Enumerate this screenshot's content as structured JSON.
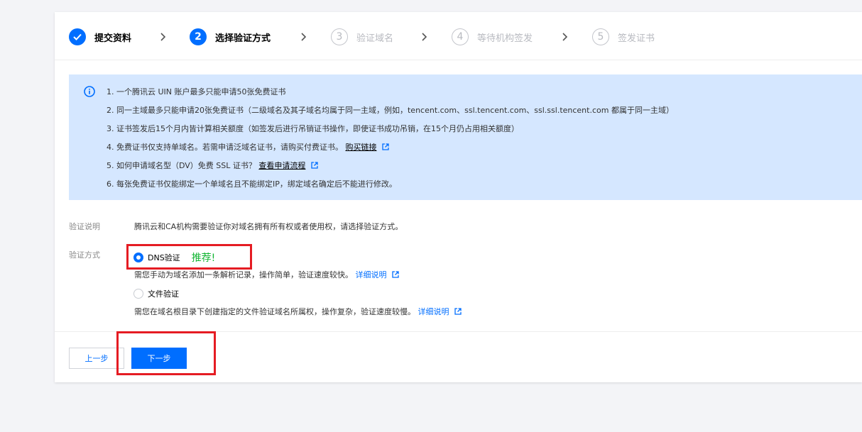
{
  "steps": [
    {
      "number": "",
      "label": "提交资料",
      "state": "done"
    },
    {
      "number": "2",
      "label": "选择验证方式",
      "state": "active"
    },
    {
      "number": "3",
      "label": "验证域名",
      "state": "pending"
    },
    {
      "number": "4",
      "label": "等待机构签发",
      "state": "pending"
    },
    {
      "number": "5",
      "label": "签发证书",
      "state": "pending"
    }
  ],
  "notice": {
    "line1": "1. 一个腾讯云 UIN 账户最多只能申请50张免费证书",
    "line2": "2. 同一主域最多只能申请20张免费证书（二级域名及其子域名均属于同一主域，例如，tencent.com、ssl.tencent.com、ssl.ssl.tencent.com 都属于同一主域）",
    "line3": "3. 证书签发后15个月内皆计算相关额度（如签发后进行吊销证书操作，即使证书成功吊销，在15个月仍占用相关额度）",
    "line4_text": "4. 免费证书仅支持单域名。若需申请泛域名证书，请购买付费证书。",
    "line4_link": "购买链接",
    "line5_text": "5. 如何申请域名型（DV）免费 SSL 证书？",
    "line5_link": "查看申请流程",
    "line6": "6. 每张免费证书仅能绑定一个单域名且不能绑定IP，绑定域名确定后不能进行修改。"
  },
  "form": {
    "desc_label": "验证说明",
    "desc_text": "腾讯云和CA机构需要验证你对域名拥有所有权或者使用权，请选择验证方式。",
    "method_label": "验证方式",
    "options": [
      {
        "label": "DNS验证",
        "badge": "推荐!",
        "checked": true,
        "desc": "需您手动为域名添加一条解析记录，操作简单，验证速度较快。",
        "link": "详细说明"
      },
      {
        "label": "文件验证",
        "checked": false,
        "desc": "需您在域名根目录下创建指定的文件验证域名所属权，操作复杂，验证速度较慢。",
        "link": "详细说明"
      }
    ]
  },
  "buttons": {
    "prev": "上一步",
    "next": "下一步"
  },
  "colors": {
    "primary": "#006eff",
    "notice_bg": "#d5e7ff",
    "recommend": "#11b532",
    "highlight": "#e51c23"
  }
}
